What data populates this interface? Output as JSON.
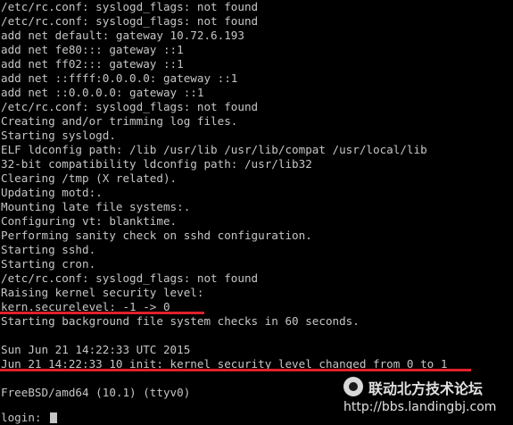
{
  "console": {
    "lines": [
      "/etc/rc.conf: syslogd_flags: not found",
      "/etc/rc.conf: syslogd_flags: not found",
      "add net default: gateway 10.72.6.193",
      "add net fe80::: gateway ::1",
      "add net ff02::: gateway ::1",
      "add net ::ffff:0.0.0.0: gateway ::1",
      "add net ::0.0.0.0: gateway ::1",
      "/etc/rc.conf: syslogd_flags: not found",
      "Creating and/or trimming log files.",
      "Starting syslogd.",
      "ELF ldconfig path: /lib /usr/lib /usr/lib/compat /usr/local/lib",
      "32-bit compatibility ldconfig path: /usr/lib32",
      "Clearing /tmp (X related).",
      "Updating motd:.",
      "Mounting late file systems:.",
      "Configuring vt: blanktime.",
      "Performing sanity check on sshd configuration.",
      "Starting sshd.",
      "Starting cron.",
      "/etc/rc.conf: syslogd_flags: not found",
      "Raising kernel security level:",
      "kern.securelevel: -1 -> 0",
      "Starting background file system checks in 60 seconds.",
      "",
      "Sun Jun 21 14:22:33 UTC 2015",
      "Jun 21 14:22:33 10 init: kernel security level changed from 0 to 1",
      "",
      "FreeBSD/amd64 (10.1) (ttyv0)",
      "",
      "login: "
    ]
  },
  "watermark": {
    "title": "联动北方技术论坛",
    "url": "http://bbs.landingbj.com"
  },
  "colors": {
    "background": "#000000",
    "text": "#c6c6c6",
    "highlight_underline": "#e1212a"
  }
}
